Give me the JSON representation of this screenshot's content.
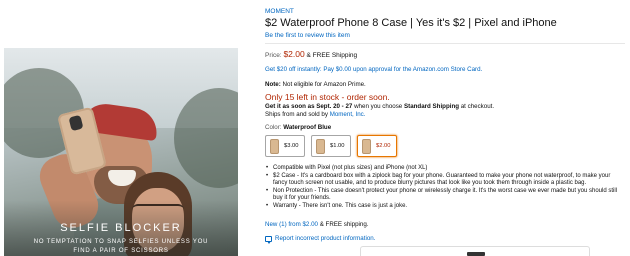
{
  "image": {
    "caption_title": "SELFIE BLOCKER",
    "caption_line1": "NO TEMPTATION TO SNAP SELFIES UNLESS YOU",
    "caption_line2": "FIND A PAIR OF SCISSORS"
  },
  "product": {
    "brand": "MOMENT",
    "title": "$2 Waterproof Phone 8 Case | Yes it's $2 | Pixel and iPhone",
    "review_link": "Be the first to review this item",
    "price_label": "Price:",
    "price": "$2.00",
    "free_shipping": "& FREE Shipping",
    "offer": "Get $20 off instantly: Pay $0.00 upon approval for the Amazon.com Store Card.",
    "note_label": "Note:",
    "note_text": "Not eligible for Amazon Prime.",
    "stock": "Only 15 left in stock - order soon.",
    "delivery_prefix": "Get it as soon as Sept. 20 - 27",
    "delivery_mid": "when you choose",
    "delivery_option": "Standard Shipping",
    "delivery_suffix": "at checkout.",
    "ships_prefix": "Ships from and sold by",
    "seller": "Moment, Inc.",
    "color_label": "Color:",
    "color_value": "Waterproof Blue",
    "swatches": [
      {
        "price": "$3.00",
        "selected": false
      },
      {
        "price": "$1.00",
        "selected": false
      },
      {
        "price": "$2.00",
        "selected": true
      }
    ],
    "bullets": [
      "Compatible with Pixel (not plus sizes) and iPhone (not XL)",
      "$2 Case - It's a cardboard box with a ziplock bag for your phone. Guaranteed to make your phone not waterproof, to make your fancy touch screen not usable, and to produce blurry pictures that look like you took them through inside a plastic bag.",
      "Non Protection - This case doesn't protect your phone or wirelessly charge it. It's the worst case we ever made but you should still buy it for your friends.",
      "Warranty - There isn't one. This case is just a joke."
    ],
    "new_link": "New (1) from $2.00",
    "new_suffix": "& FREE shipping.",
    "report_link": "Report incorrect product information."
  },
  "colors": {
    "link": "#0066c0",
    "price_red": "#b12704",
    "selected_border": "#e77600"
  }
}
